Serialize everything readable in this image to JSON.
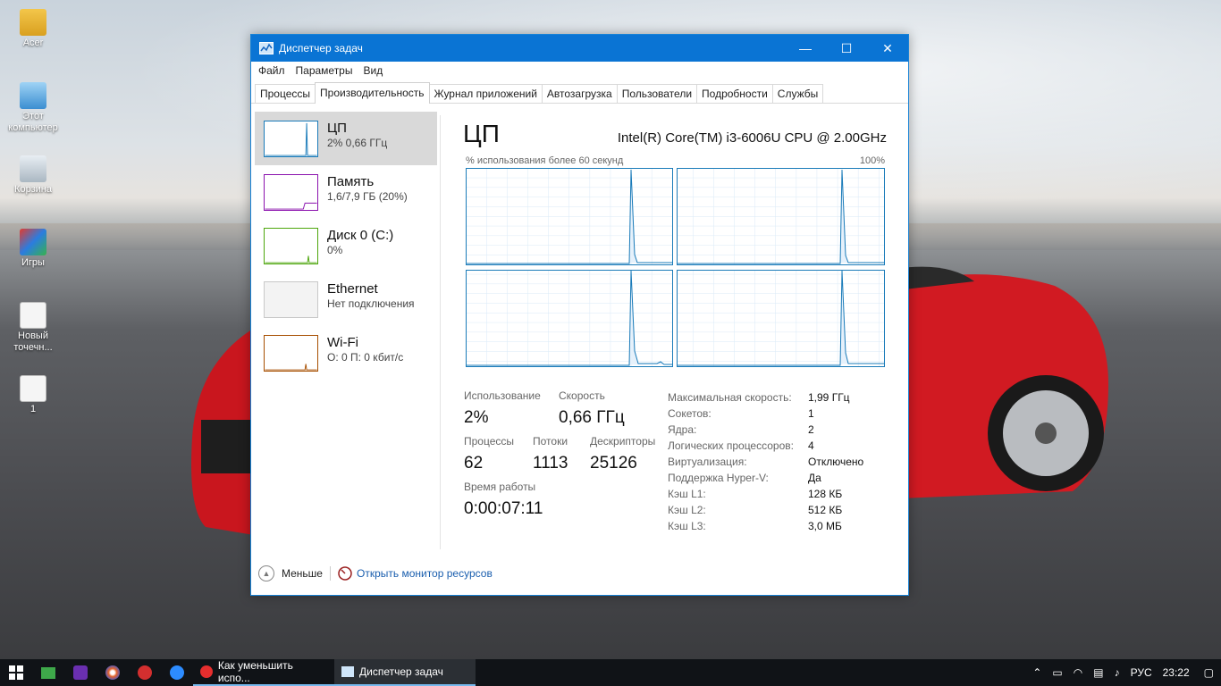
{
  "desktop": {
    "icons": [
      {
        "label": "Acer"
      },
      {
        "label": "Этот компьютер"
      },
      {
        "label": "Корзина"
      },
      {
        "label": "Игры"
      },
      {
        "label": "Новый точечн..."
      },
      {
        "label": "1"
      }
    ]
  },
  "window": {
    "title": "Диспетчер задач",
    "controls": {
      "minimize": "—",
      "maximize": "☐",
      "close": "✕"
    },
    "menu": [
      "Файл",
      "Параметры",
      "Вид"
    ],
    "tabs": [
      "Процессы",
      "Производительность",
      "Журнал приложений",
      "Автозагрузка",
      "Пользователи",
      "Подробности",
      "Службы"
    ],
    "active_tab": "Производительность"
  },
  "sidebar": {
    "items": [
      {
        "title": "ЦП",
        "subtitle": "2% 0,66 ГГц",
        "color": "#1a7bb9"
      },
      {
        "title": "Память",
        "subtitle": "1,6/7,9 ГБ (20%)",
        "color": "#8b12ae"
      },
      {
        "title": "Диск 0 (C:)",
        "subtitle": "0%",
        "color": "#4da60c"
      },
      {
        "title": "Ethernet",
        "subtitle": "Нет подключения",
        "color": "#c8c8c8"
      },
      {
        "title": "Wi-Fi",
        "subtitle": "О: 0 П: 0 кбит/с",
        "color": "#a74f01"
      }
    ]
  },
  "cpu": {
    "heading": "ЦП",
    "model": "Intel(R) Core(TM) i3-6006U CPU @ 2.00GHz",
    "graph_label": "% использования более 60 секунд",
    "graph_max": "100%",
    "stats": {
      "usage_label": "Использование",
      "usage_value": "2%",
      "speed_label": "Скорость",
      "speed_value": "0,66 ГГц",
      "processes_label": "Процессы",
      "processes_value": "62",
      "threads_label": "Потоки",
      "threads_value": "1113",
      "handles_label": "Дескрипторы",
      "handles_value": "25126",
      "uptime_label": "Время работы",
      "uptime_value": "0:00:07:11"
    },
    "specs": [
      {
        "k": "Максимальная скорость:",
        "v": "1,99 ГГц"
      },
      {
        "k": "Сокетов:",
        "v": "1"
      },
      {
        "k": "Ядра:",
        "v": "2"
      },
      {
        "k": "Логических процессоров:",
        "v": "4"
      },
      {
        "k": "Виртуализация:",
        "v": "Отключено"
      },
      {
        "k": "Поддержка Hyper-V:",
        "v": "Да"
      },
      {
        "k": "Кэш L1:",
        "v": "128 КБ"
      },
      {
        "k": "Кэш L2:",
        "v": "512 КБ"
      },
      {
        "k": "Кэш L3:",
        "v": "3,0 МБ"
      }
    ]
  },
  "bottom": {
    "less_label": "Меньше",
    "monitor_link": "Открыть монитор ресурсов"
  },
  "taskbar": {
    "apps": [
      {
        "label": "Как уменьшить испо..."
      },
      {
        "label": "Диспетчер задач"
      }
    ],
    "language": "РУС",
    "time": "23:22"
  }
}
